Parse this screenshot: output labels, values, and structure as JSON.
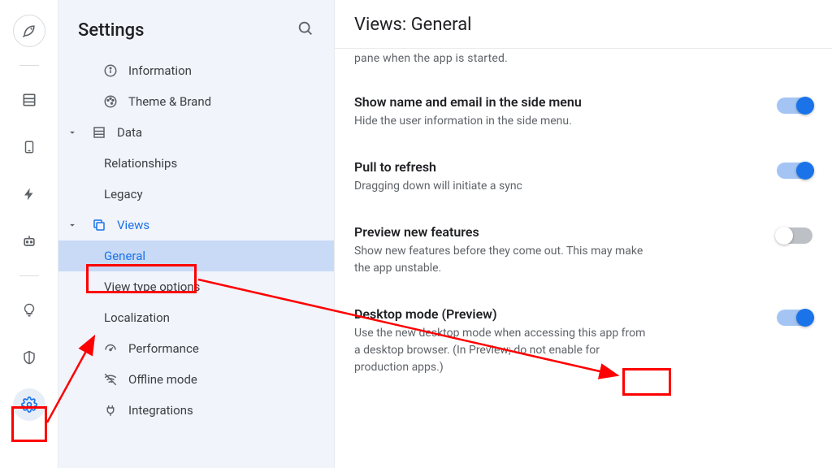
{
  "sidebar": {
    "title": "Settings",
    "items": {
      "information": "Information",
      "theme": "Theme & Brand",
      "data": "Data",
      "relationships": "Relationships",
      "legacy": "Legacy",
      "views": "Views",
      "general": "General",
      "view_type_options": "View type options",
      "localization": "Localization",
      "performance": "Performance",
      "offline": "Offline mode",
      "integrations": "Integrations"
    }
  },
  "main": {
    "header": "Views: General",
    "truncated_prev_line": "pane when the app is started.",
    "settings": {
      "show_name_email": {
        "title": "Show name and email in the side menu",
        "desc": "Hide the user information in the side menu.",
        "on": true
      },
      "pull_refresh": {
        "title": "Pull to refresh",
        "desc": "Dragging down will initiate a sync",
        "on": true
      },
      "preview_new": {
        "title": "Preview new features",
        "desc": "Show new features before they come out. This may make the app unstable.",
        "on": false
      },
      "desktop_mode": {
        "title": "Desktop mode (Preview)",
        "desc": "Use the new desktop mode when accessing this app from a desktop browser. (In Preview; do not enable for production apps.)",
        "on": true
      }
    }
  },
  "colors": {
    "accent": "#1a73e8",
    "annotation": "#ff0000"
  }
}
